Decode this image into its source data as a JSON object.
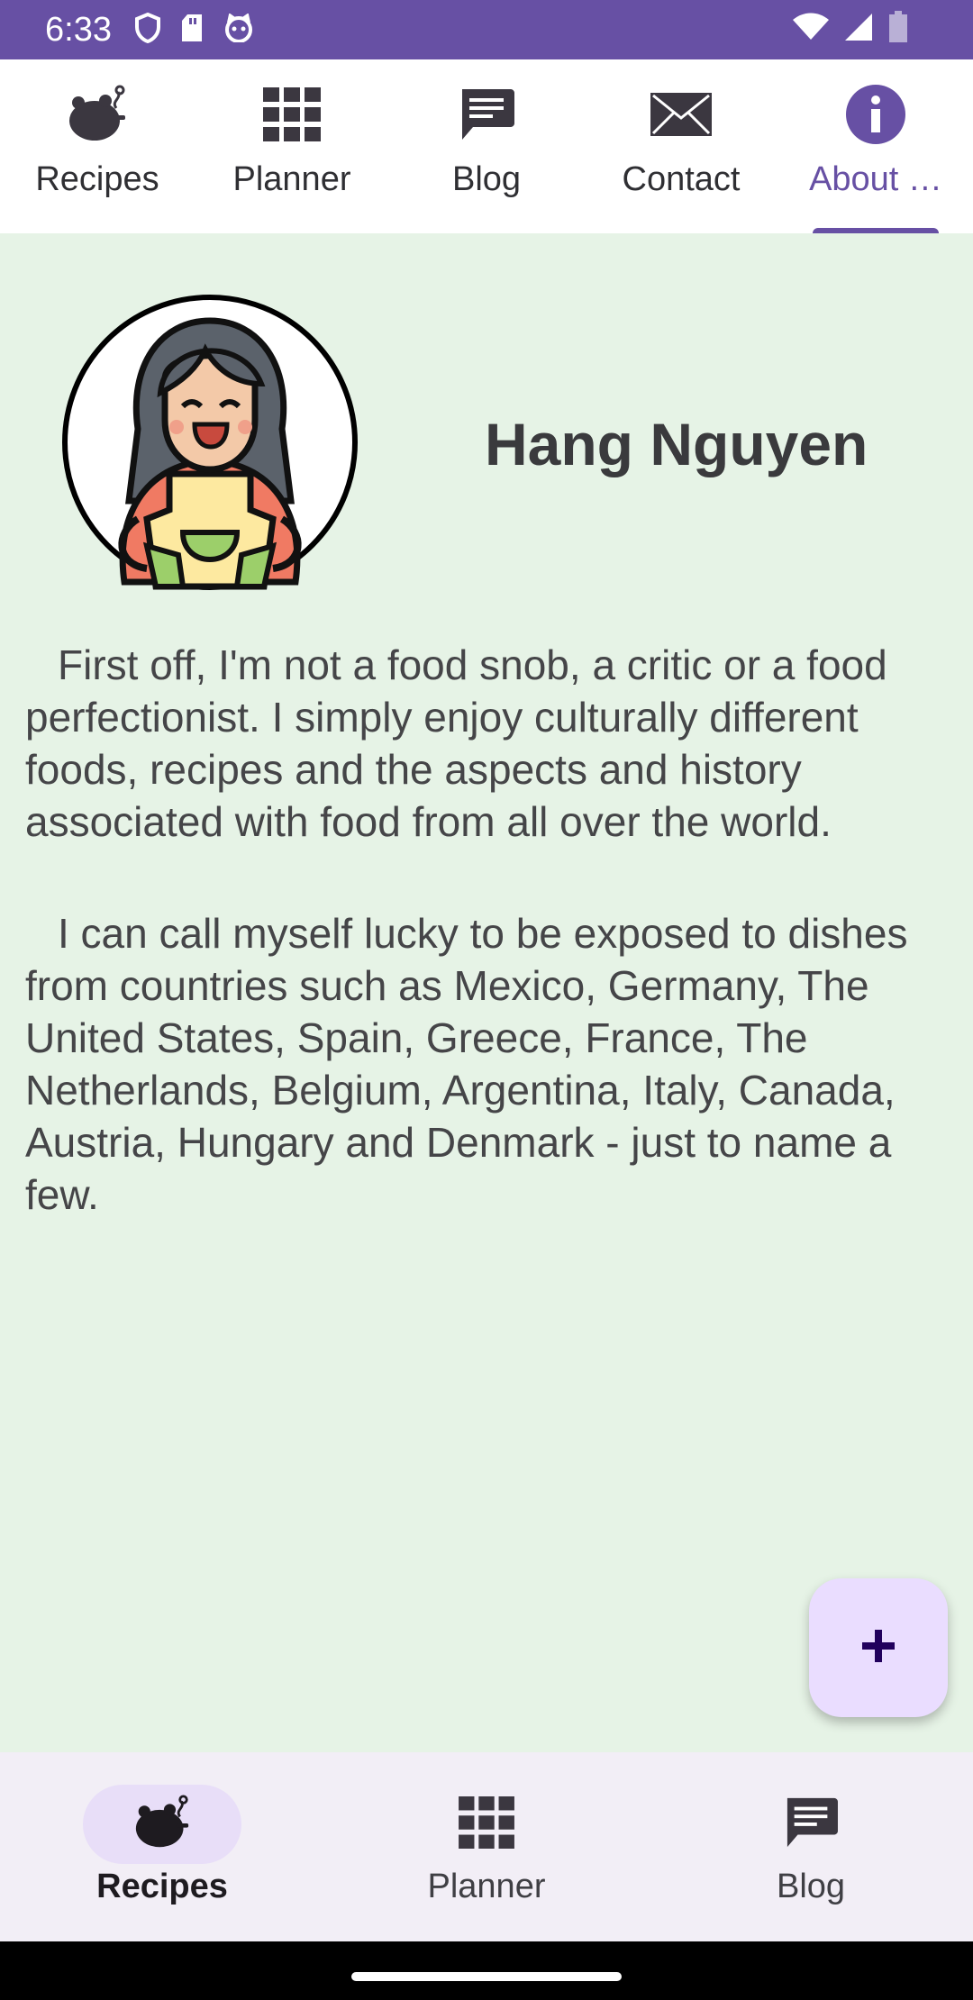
{
  "status_bar": {
    "time": "6:33",
    "icons": [
      "shield-icon",
      "sd-card-icon",
      "cat-icon",
      "wifi-icon",
      "cell-signal-icon",
      "battery-icon"
    ]
  },
  "top_tabs": [
    {
      "label": "Recipes",
      "icon": "turkey-icon",
      "active": false
    },
    {
      "label": "Planner",
      "icon": "grid-icon",
      "active": false
    },
    {
      "label": "Blog",
      "icon": "chat-icon",
      "active": false
    },
    {
      "label": "Contact",
      "icon": "envelope-icon",
      "active": false
    },
    {
      "label": "About …",
      "icon": "info-icon",
      "active": true
    }
  ],
  "profile": {
    "name": "Hang Nguyen",
    "avatar_icon": "chef-woman-avatar"
  },
  "bio": [
    "First off, I'm not a food snob, a critic or a food perfectionist. I simply enjoy culturally different foods, recipes and the aspects and history associated with food from all over the world.",
    "I can call myself lucky to be exposed to dishes from countries such as Mexico, Germany, The United States, Spain, Greece, France, The Netherlands, Belgium, Argentina, Italy, Canada, Austria, Hungary and Denmark - just to name a few."
  ],
  "fab": {
    "icon": "plus-icon"
  },
  "bottom_nav": [
    {
      "label": "Recipes",
      "icon": "turkey-icon",
      "active": true
    },
    {
      "label": "Planner",
      "icon": "grid-icon",
      "active": false
    },
    {
      "label": "Blog",
      "icon": "chat-icon",
      "active": false
    }
  ],
  "colors": {
    "primary": "#6750a4",
    "content_bg": "#e6f3e6",
    "fab_bg": "#eaddff",
    "nav_bg": "#f2eef6"
  }
}
